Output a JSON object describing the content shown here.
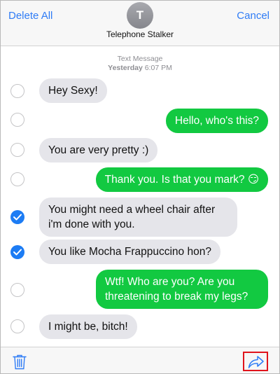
{
  "header": {
    "delete_all_label": "Delete All",
    "cancel_label": "Cancel",
    "avatar_initial": "T",
    "contact_name": "Telephone Stalker"
  },
  "timestamp": {
    "line1": "Text Message",
    "line2_day": "Yesterday",
    "line2_time": "6:07 PM"
  },
  "messages": [
    {
      "text": "Hey Sexy!",
      "direction": "incoming",
      "selected": false
    },
    {
      "text": "Hello, who's this?",
      "direction": "outgoing",
      "selected": false
    },
    {
      "text": "You are very pretty :)",
      "direction": "incoming",
      "selected": false
    },
    {
      "text": "Thank you. Is that you mark? 😏",
      "direction": "outgoing",
      "selected": false
    },
    {
      "text": "You might need a wheel chair after i'm done with you.",
      "direction": "incoming",
      "selected": true
    },
    {
      "text": "You like Mocha Frappuccino hon?",
      "direction": "incoming",
      "selected": true
    },
    {
      "text": "Wtf! Who are you? Are you threatening to break my legs?",
      "direction": "outgoing",
      "selected": false
    },
    {
      "text": "I might be, bitch!",
      "direction": "incoming",
      "selected": false
    }
  ],
  "toolbar": {
    "trash_icon": "trash-icon",
    "forward_icon": "forward-arrow-icon"
  },
  "colors": {
    "accent": "#2f7cf6",
    "outgoing_bubble": "#12c941",
    "incoming_bubble": "#e5e5ea",
    "checked": "#1c7cf4",
    "highlight_border": "#e0141c"
  }
}
